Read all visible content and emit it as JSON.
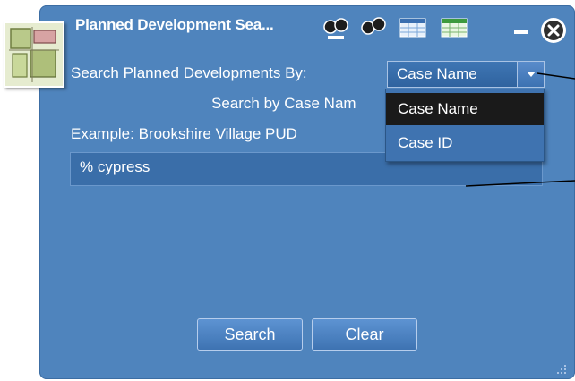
{
  "window": {
    "title": "Planned Development Sea...",
    "toolbar_icons": [
      "binoculars-icon",
      "binoculars-link-icon",
      "grid-icon",
      "table-icon"
    ],
    "controls": [
      "minimize-icon",
      "close-icon"
    ]
  },
  "search": {
    "by_label": "Search Planned Developments By:",
    "by_value": "Case Name",
    "options": [
      "Case Name",
      "Case ID"
    ],
    "selected_option": "Case Name",
    "subheading": "Search by Case Nam",
    "example": "Example: Brookshire Village PUD",
    "input_value": "% cypress"
  },
  "buttons": {
    "search": "Search",
    "clear": "Clear"
  },
  "colors": {
    "panel": "#4f84bd",
    "selected_item": "#1a1a1a",
    "text": "#ffffff"
  }
}
